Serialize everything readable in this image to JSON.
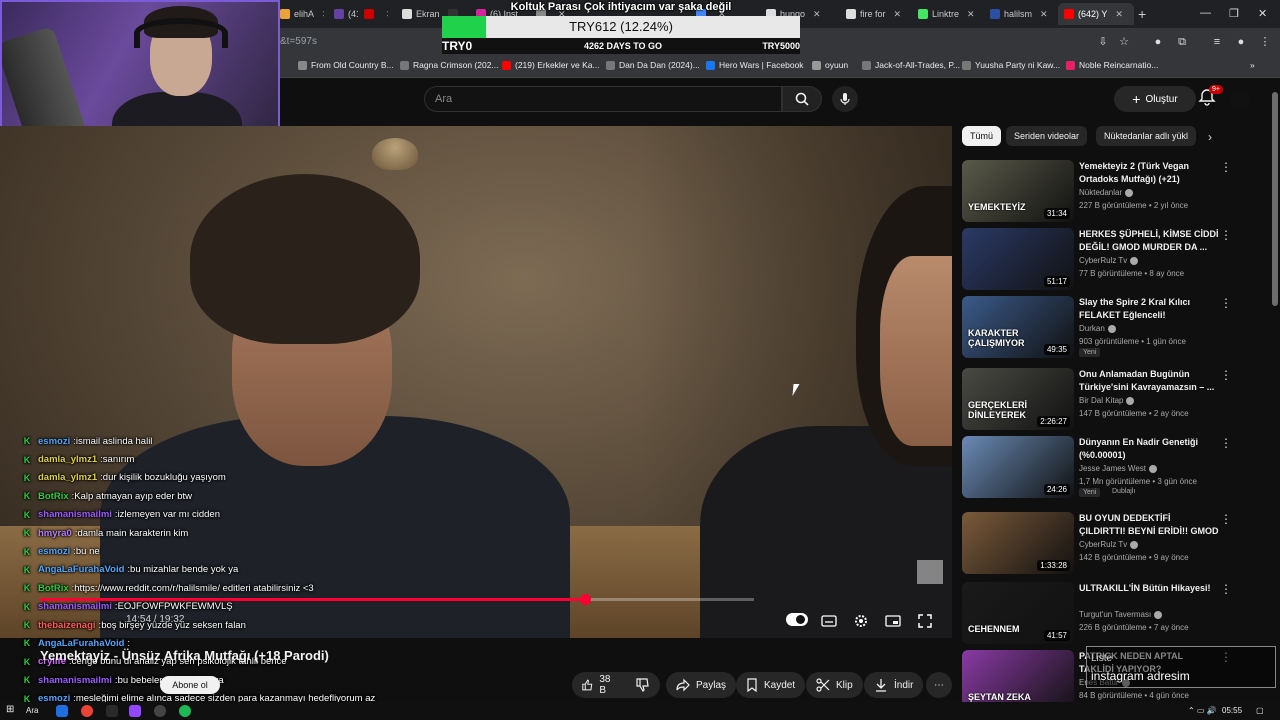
{
  "browser": {
    "tabs": [
      {
        "label": "elihA",
        "color": "#e9a33a"
      },
      {
        "label": "(41",
        "color": "#6441a5"
      },
      {
        "label": "",
        "color": "#cc0000"
      },
      {
        "label": "Ekran",
        "color": "#dddddd"
      },
      {
        "label": "",
        "color": "#333333"
      },
      {
        "label": "(6) Inst",
        "color": "#d6249f"
      },
      {
        "label": "",
        "color": "#888888"
      },
      {
        "label": "",
        "color": "#4285f4"
      },
      {
        "label": "hungo",
        "color": "#dddddd"
      },
      {
        "label": "fire for",
        "color": "#dddddd"
      },
      {
        "label": "Linktre",
        "color": "#43e660"
      },
      {
        "label": "halilsm",
        "color": "#2b4fa3"
      },
      {
        "label": "(642) Y",
        "color": "#ff0000"
      }
    ],
    "url": "&t=597s",
    "bookmarks": [
      {
        "label": "From Old Country B..."
      },
      {
        "label": "Ragna Crimson (202..."
      },
      {
        "label": "(219) Erkekler ve Ka..."
      },
      {
        "label": "Dan Da Dan (2024)..."
      },
      {
        "label": "Hero Wars | Facebook"
      },
      {
        "label": "oyuun"
      },
      {
        "label": "Jack-of-All-Trades, P..."
      },
      {
        "label": "Yuusha Party ni Kaw..."
      },
      {
        "label": "Noble Reincarnatio..."
      }
    ]
  },
  "donation": {
    "title": "Koltuk Parası Çok ihtiyacım var şaka değil",
    "amount": "TRY612 (12.24%)",
    "percent": 12.24,
    "start": "TRY0",
    "days": "4262 DAYS TO GO",
    "goal": "TRY5000"
  },
  "youtube": {
    "search_placeholder": "Ara",
    "create_label": "Oluştur",
    "notif_count": "9+"
  },
  "player": {
    "time": "14:54 / 19:32",
    "progress": 0.7635
  },
  "chat": [
    {
      "user": "esmozi",
      "color": "#4ea6ff",
      "msg": "ismail aslinda halil"
    },
    {
      "user": "damla_ylmz1",
      "color": "#e0d33c",
      "msg": "sanırım"
    },
    {
      "user": "damla_ylmz1",
      "color": "#e0d33c",
      "msg": "dur kişilik bozukluğu yaşıyom"
    },
    {
      "user": "BotRix",
      "color": "#2ecc40",
      "msg": "Kalp atmayan ayıp eder btw"
    },
    {
      "user": "shamanismailmi",
      "color": "#9b59ff",
      "msg": "izlemeyen var mı cidden"
    },
    {
      "user": "hmyra0",
      "color": "#b57cff",
      "msg": "damla main karakterin kim"
    },
    {
      "user": "esmozi",
      "color": "#4ea6ff",
      "msg": "bu ne"
    },
    {
      "user": "AngaLaFurahaVoid",
      "color": "#4ea6ff",
      "msg": "bu mizahlar bende yok ya"
    },
    {
      "user": "BotRix",
      "color": "#2ecc40",
      "msg": "https://www.reddit.com/r/halilsmile/ editleri atabilirsiniz <3"
    },
    {
      "user": "shamanismailmi",
      "color": "#9b59ff",
      "msg": "EOJFOWFPWKFEWMVLŞ"
    },
    {
      "user": "thebaizenagi",
      "color": "#ff5a5a",
      "msg": "boş birşey yüzde yüz seksen falan"
    },
    {
      "user": "AngaLaFurahaVoid",
      "color": "#4ea6ff",
      "msg": ""
    },
    {
      "user": "crylife",
      "color": "#d46bff",
      "msg": "cengo bunu di analiz yap sen psikolojik tahlil bence"
    },
    {
      "user": "shamanismailmi",
      "color": "#9b59ff",
      "msg": "bu bebeler neler dicek ya"
    },
    {
      "user": "esmozi",
      "color": "#4ea6ff",
      "msg": "mesleğimi elime alınca sadece sizden para kazanmayı hedefliyorum az"
    }
  ],
  "video": {
    "title": "Yemektayiz - Ünsüz Afrika Mutfağı (+18 Parodi)",
    "subscribe_label": "Abone ol",
    "like_count": "38 B",
    "share_label": "Paylaş",
    "save_label": "Kaydet",
    "clip_label": "Klip",
    "download_label": "İndir"
  },
  "chips": [
    "Tümü",
    "Seriden videolar",
    "Nüktedanlar adlı yükl"
  ],
  "recommendations": [
    {
      "title": "Yemekteyiz 2 (Türk Vegan Ortadoks Mutfağı) (+21)",
      "channel": "Nüktedanlar",
      "views": "227 B görüntüleme",
      "age": "2 yıl önce",
      "duration": "31:34",
      "thumb_text": "YEMEKTEYİZ",
      "bg": "#5a5a4a",
      "new": false,
      "dub": false
    },
    {
      "title": "HERKES ŞÜPHELİ, KİMSE CİDDİ DEĞİL! GMOD MURDER DA ...",
      "channel": "CyberRulz Tv",
      "views": "77 B görüntüleme",
      "age": "8 ay önce",
      "duration": "51:17",
      "thumb_text": "",
      "bg": "#2b3a66",
      "new": false,
      "dub": false
    },
    {
      "title": "Slay the Spire 2 Kral Kılıcı FELAKET Eğlenceli!",
      "channel": "Durkan",
      "views": "903 görüntüleme",
      "age": "1 gün önce",
      "duration": "49:35",
      "thumb_text": "KARAKTER ÇALIŞMIYOR",
      "bg": "#3b5a8a",
      "new": true,
      "dub": false
    },
    {
      "title": "Onu Anlamadan Bugünün Türkiye'sini Kavrayamazsın – ...",
      "channel": "Bir Dal Kitap",
      "views": "147 B görüntüleme",
      "age": "2 ay önce",
      "duration": "2:26:27",
      "thumb_text": "GERÇEKLERİ DİNLEYEREK",
      "bg": "#4a4a44",
      "new": false,
      "dub": false
    },
    {
      "title": "Dünyanın En Nadir Genetiği (%0.00001)",
      "channel": "Jesse James West",
      "views": "1,7 Mn görüntüleme",
      "age": "3 gün önce",
      "duration": "24:26",
      "thumb_text": "",
      "bg": "#6a8ab5",
      "new": true,
      "dub": true,
      "dub_label": "Dublajlı"
    },
    {
      "title": "BU OYUN DEDEKTİFİ ÇILDIRTTI! BEYNİ ERİDİ!! GMOD KATİL KİM",
      "channel": "CyberRulz Tv",
      "views": "142 B görüntüleme",
      "age": "9 ay önce",
      "duration": "1:33:28",
      "thumb_text": "",
      "bg": "#7a5a3a",
      "new": false,
      "dub": false
    },
    {
      "title": "ULTRAKILL'İN Bütün Hikayesi!",
      "channel": "Turgut'un Taverması",
      "views": "226 B görüntüleme",
      "age": "7 ay önce",
      "duration": "41:57",
      "thumb_text": "CEHENNEM",
      "bg": "#1a1a1a",
      "new": false,
      "dub": false
    },
    {
      "title": "PATRICK NEDEN APTAL TAKLİDİ YAPIYOR?",
      "channel": "Enes Batur",
      "views": "84 B görüntüleme",
      "age": "4 gün önce",
      "duration": "",
      "thumb_text": "ŞEYTAN ZEKA",
      "bg": "#8a3aa5",
      "new": false,
      "dub": false
    }
  ],
  "insta": {
    "label": "Liste",
    "text": "instagram adresim"
  },
  "taskbar": {
    "search_label": "Ara",
    "clock": "05:55"
  }
}
